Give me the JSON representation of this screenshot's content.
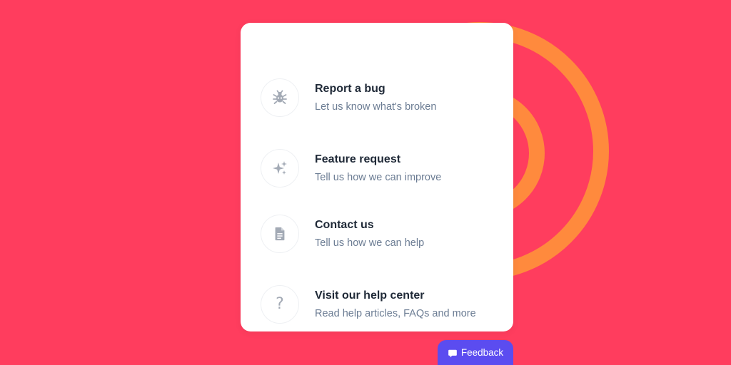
{
  "colors": {
    "background": "#ff3d5e",
    "ring": "#ff8a3d",
    "card": "#ffffff",
    "feedback_button": "#5b4cf0"
  },
  "menu": {
    "items": [
      {
        "icon": "bug-icon",
        "title": "Report a bug",
        "description": "Let us know what's broken"
      },
      {
        "icon": "sparkles-icon",
        "title": "Feature request",
        "description": "Tell us how we can improve"
      },
      {
        "icon": "document-icon",
        "title": "Contact us",
        "description": "Tell us how we can help"
      },
      {
        "icon": "question-icon",
        "title": "Visit our help center",
        "description": "Read help articles, FAQs and more",
        "glyph": "?"
      }
    ]
  },
  "feedback": {
    "icon": "chat-bubble-icon",
    "label": "Feedback"
  }
}
